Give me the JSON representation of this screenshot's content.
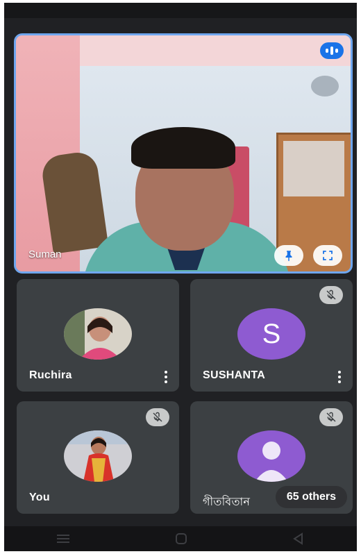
{
  "main": {
    "name": "Suman"
  },
  "tiles": [
    {
      "name": "Ruchira"
    },
    {
      "name": "SUSHANTA",
      "initial": "S"
    },
    {
      "name": "You"
    },
    {
      "name": "গীতবিতান",
      "others": "65 others"
    }
  ],
  "colors": {
    "accent": "#1a73e8",
    "highlight_border": "#6fa6ee",
    "tile_bg": "#3c4043",
    "avatar_purple": "#8e5bd1"
  },
  "icons": {
    "speaking": "audio-bars-icon",
    "pin": "pin-icon",
    "fullscreen": "fullscreen-icon",
    "muted": "mic-off-icon",
    "more": "more-vert-icon",
    "person": "person-icon"
  }
}
